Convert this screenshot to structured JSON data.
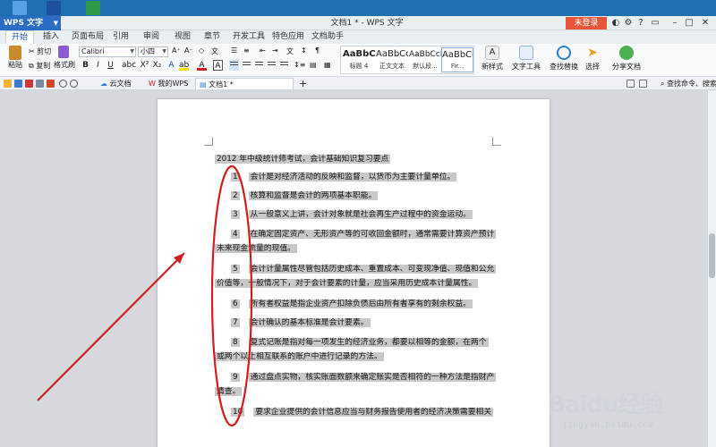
{
  "window": {
    "app_button": "WPS 文字",
    "title": "文档1 * - WPS 文字",
    "login_button": "未登录"
  },
  "menu_tabs": [
    "开始",
    "插入",
    "页面布局",
    "引用",
    "审阅",
    "视图",
    "章节",
    "开发工具",
    "特色应用",
    "文档助手"
  ],
  "ribbon": {
    "paste": "粘贴",
    "cut": "剪切",
    "copy": "复制",
    "format_painter": "格式刷",
    "font_name": "Calibri",
    "font_size": "小四",
    "styles": [
      {
        "preview": "AaBbC",
        "label": "标题 4"
      },
      {
        "preview": "AaBbCc",
        "label": "正文文本"
      },
      {
        "preview": "AaBbCcD",
        "label": "默认段..."
      },
      {
        "preview": "AaBbCc",
        "label": "Fir..."
      }
    ],
    "new_style": "新样式",
    "text_tools": "文字工具",
    "find_replace": "查找替换",
    "select": "选择",
    "share_doc": "分享文档"
  },
  "quickbar": {
    "tabs": [
      "云文档",
      "我的WPS",
      "文档1 *"
    ],
    "search": "查找命令、搜索模板"
  },
  "document": {
    "heading": "2012 年中级统计师考试，会计基础知识复习要点",
    "items": [
      {
        "num": "1",
        "lines": [
          "会计是对经济活动的反映和监督，以货币为主要计量单位。"
        ]
      },
      {
        "num": "2",
        "lines": [
          "核算和监督是会计的两项基本职能。"
        ]
      },
      {
        "num": "3",
        "lines": [
          "从一般意义上讲，会计对象就是社会再生产过程中的资金运动。"
        ]
      },
      {
        "num": "4",
        "lines": [
          "在确定固定资产、无形资产等的可收回金额时，通常需要计算资产预计",
          "未来现金流量的现值。"
        ]
      },
      {
        "num": "5",
        "lines": [
          "会计计量属性尽管包括历史成本、重置成本、可变现净值、现值和公允",
          "价值等，一般情况下，对于会计要素的计量，应当采用历史成本计量属性。"
        ]
      },
      {
        "num": "6",
        "lines": [
          "所有者权益是指企业资产扣除负债后由所有者享有的剩余权益。"
        ]
      },
      {
        "num": "7",
        "lines": [
          "会计确认的基本标准是会计要素。"
        ]
      },
      {
        "num": "8",
        "lines": [
          "复式记账是指对每一项发生的经济业务，都要以相等的金额，在两个",
          "或两个以上相互联系的账户中进行记录的方法。"
        ]
      },
      {
        "num": "9",
        "lines": [
          "通过盘点实物，核实账面数额来确定账实是否相符的一种方法是指财产",
          "清查。"
        ]
      },
      {
        "num": "10",
        "lines": [
          "要求企业提供的会计信息应当与财务报告使用者的经济决策需要相关"
        ]
      }
    ]
  },
  "annotation": {
    "color": "#d11f1f"
  },
  "watermark": {
    "brand": "Baidu经验",
    "url": "jingyan.baidu.com"
  }
}
